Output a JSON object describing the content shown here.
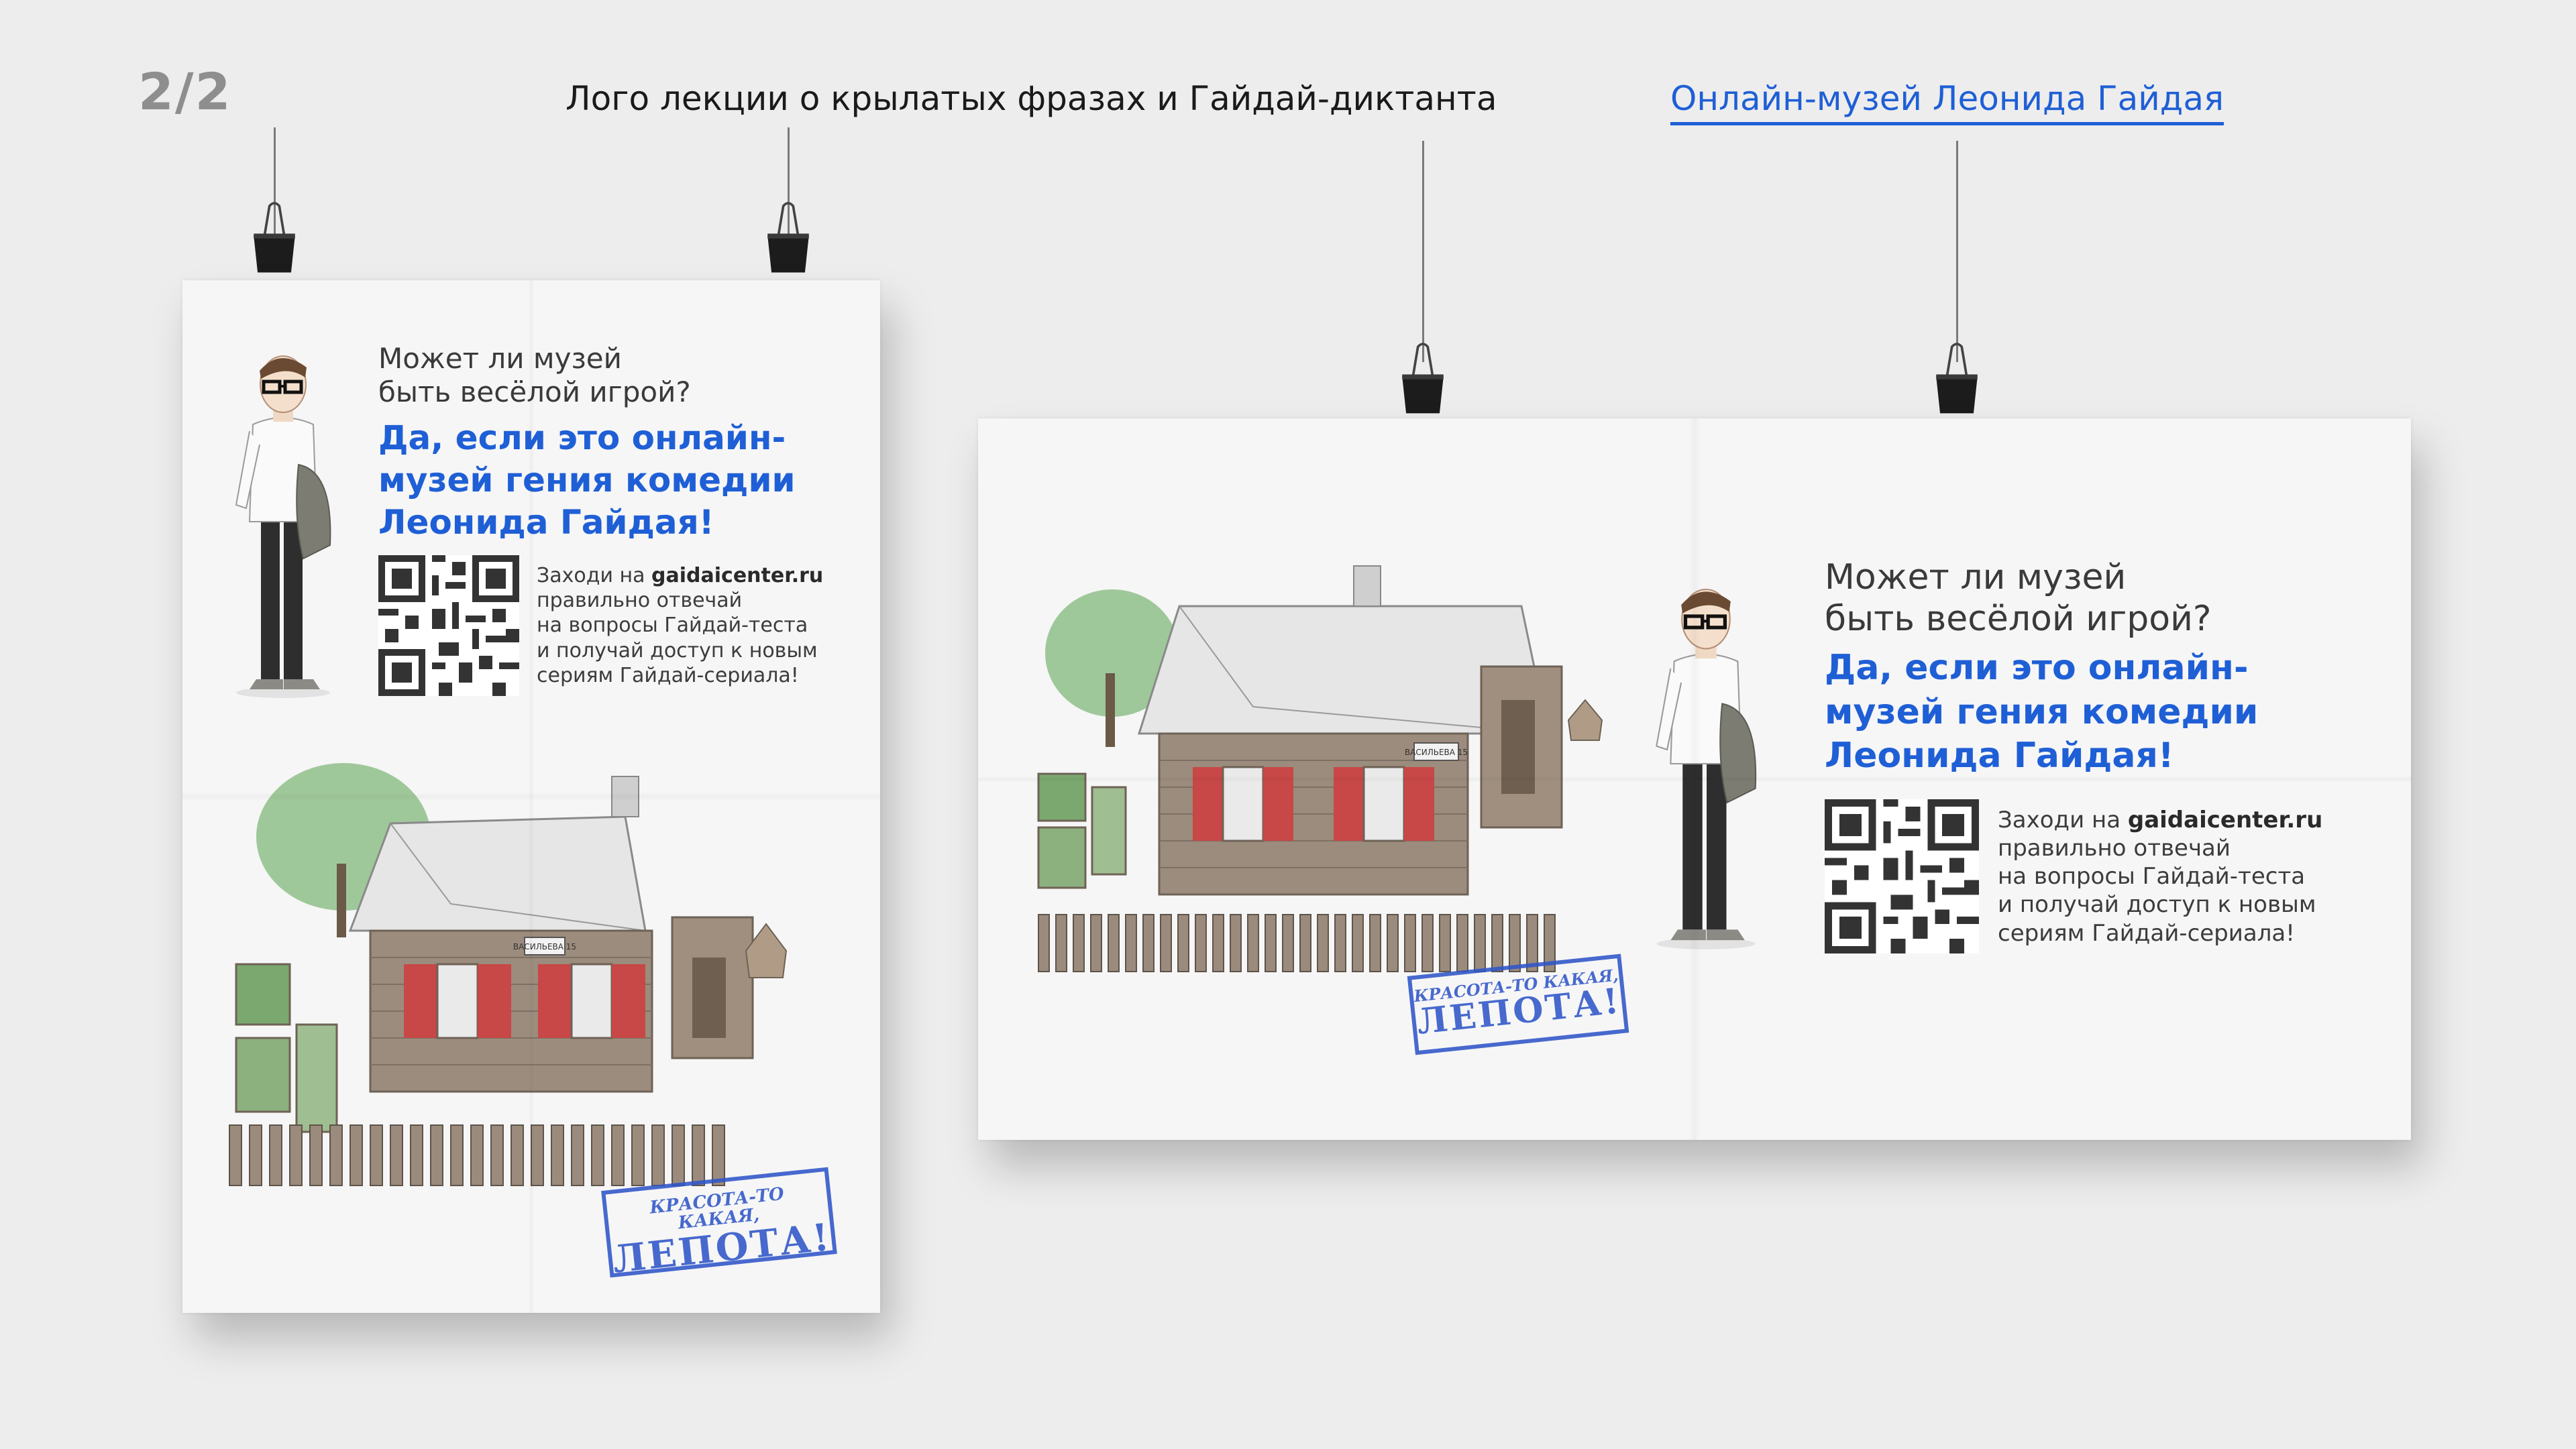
{
  "page_indicator": "2/2",
  "nav": {
    "link_1": "Лого лекции о крылатых фразах и Гайдай-диктанта",
    "link_2": "Онлайн-музей Леонида Гайдая"
  },
  "poster": {
    "question_line_1": "Может ли музей",
    "question_line_2": "быть весёлой игрой?",
    "answer_line_1": "Да, если это онлайн-",
    "answer_line_2": "музей гения комедии",
    "answer_line_3": "Леонида Гайдая!",
    "qr_prefix": "Заходи на",
    "qr_site": "gaidaicenter.ru",
    "qr_line_2": "правильно отвечай",
    "qr_line_3": "на вопросы Гайдай-теста",
    "qr_line_4": "и получай доступ к новым",
    "qr_line_5": "сериям Гайдай-сериала!",
    "stamp_line_1": "КРАСОТА-ТО КАКАЯ,",
    "stamp_line_2": "ЛЕПОТА!",
    "house_sign": "ВАСИЛЬЕВА 15"
  },
  "colors": {
    "background": "#ededed",
    "accent_blue": "#1f5fd6",
    "stamp_blue": "#2f56c9",
    "page_indicator": "#8e8e8e"
  },
  "icons": [
    "binder-clip-icon",
    "qr-code-icon"
  ]
}
